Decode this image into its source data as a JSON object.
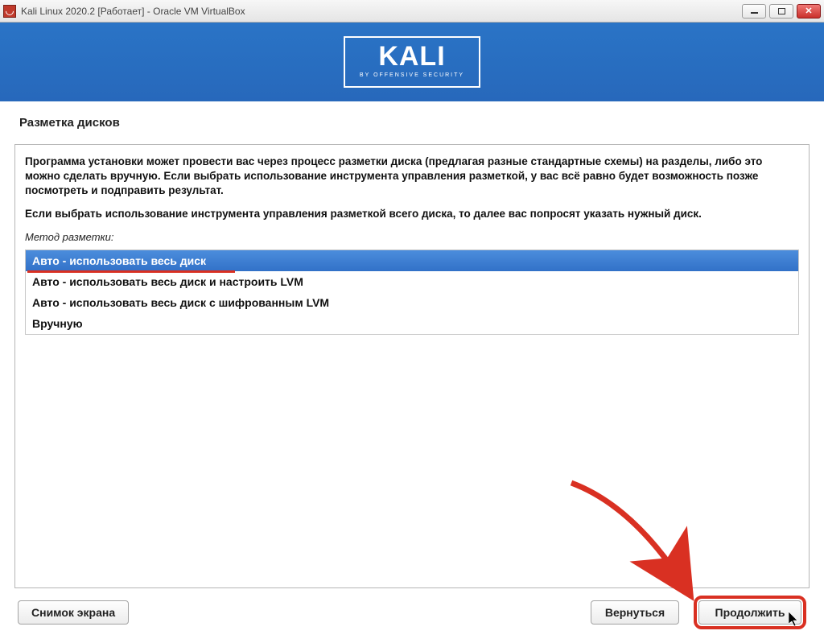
{
  "titlebar": {
    "title": "Kali Linux 2020.2 [Работает] - Oracle VM VirtualBox"
  },
  "banner": {
    "logo_big": "KALI",
    "logo_small": "BY OFFENSIVE SECURITY"
  },
  "page": {
    "title": "Разметка дисков",
    "description_p1": "Программа установки может провести вас через процесс разметки диска (предлагая разные стандартные схемы) на разделы, либо это можно сделать вручную. Если выбрать использование инструмента управления разметкой, у вас всё равно будет возможность позже посмотреть и подправить результат.",
    "description_p2": "Если выбрать использование инструмента управления разметкой всего диска, то далее вас попросят указать нужный диск.",
    "method_label": "Метод разметки:",
    "options": [
      "Авто - использовать весь диск",
      "Авто - использовать весь диск и настроить LVM",
      "Авто - использовать весь диск с шифрованным LVM",
      "Вручную"
    ],
    "selected_index": 0
  },
  "buttons": {
    "screenshot": "Снимок экрана",
    "back": "Вернуться",
    "continue": "Продолжить"
  }
}
